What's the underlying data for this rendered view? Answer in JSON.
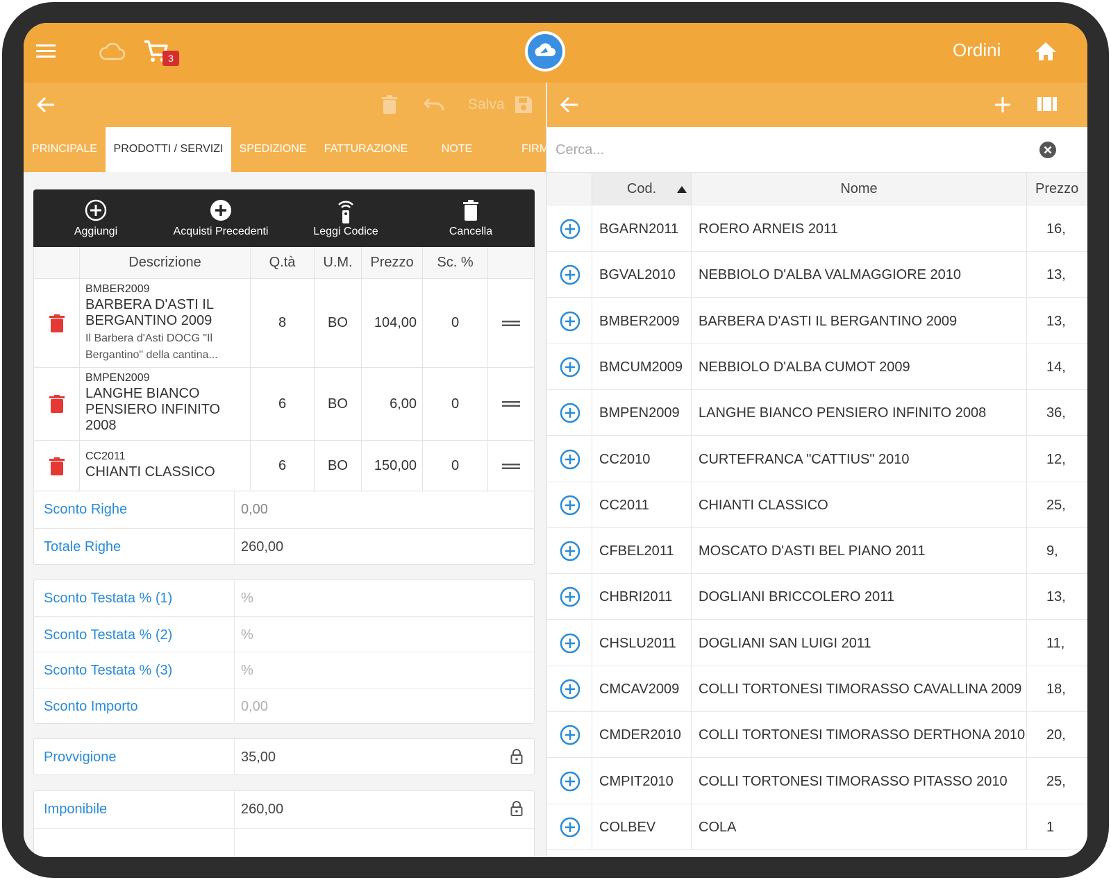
{
  "topbar": {
    "title": "Ordini",
    "cart_count": "3",
    "icons": [
      "menu-icon",
      "cloud-icon",
      "cart-icon",
      "app-logo",
      "home-icon"
    ]
  },
  "left": {
    "save_label": "Salva",
    "tabs": [
      "PRINCIPALE",
      "PRODOTTI / SERVIZI",
      "SPEDIZIONE",
      "FATTURAZIONE",
      "NOTE",
      "FIRMA"
    ],
    "active_tab": "PRODOTTI / SERVIZI",
    "toolbar": {
      "add": "Aggiungi",
      "previous": "Acquisti Precedenti",
      "read": "Leggi Codice",
      "delete": "Cancella"
    },
    "columns": {
      "desc": "Descrizione",
      "qty": "Q.tà",
      "um": "U.M.",
      "price": "Prezzo",
      "disc": "Sc. %"
    },
    "rows": [
      {
        "code": "BMBER2009",
        "name": "BARBERA D'ASTI IL BERGANTINO 2009",
        "note": "Il Barbera d'Asti DOCG \"Il Bergantino\" della cantina...",
        "qty": "8",
        "um": "BO",
        "price": "104,00",
        "disc": "0"
      },
      {
        "code": "BMPEN2009",
        "name": "LANGHE BIANCO PENSIERO INFINITO 2008",
        "note": "",
        "qty": "6",
        "um": "BO",
        "price": "6,00",
        "disc": "0"
      },
      {
        "code": "CC2011",
        "name": "CHIANTI CLASSICO",
        "note": "",
        "qty": "6",
        "um": "BO",
        "price": "150,00",
        "disc": "0"
      }
    ],
    "totals": {
      "sconto_righe_label": "Sconto Righe",
      "sconto_righe": "0,00",
      "totale_righe_label": "Totale Righe",
      "totale_righe": "260,00"
    },
    "header_discounts": {
      "t1_label": "Sconto Testata % (1)",
      "t1": "%",
      "t2_label": "Sconto Testata % (2)",
      "t2": "%",
      "t3_label": "Sconto Testata % (3)",
      "t3": "%",
      "importo_label": "Sconto Importo",
      "importo": "0,00"
    },
    "provvigione_label": "Provvigione",
    "provvigione": "35,00",
    "imponibile_label": "Imponibile",
    "imponibile": "260,00"
  },
  "right": {
    "search_placeholder": "Cerca...",
    "columns": {
      "cod": "Cod.",
      "nome": "Nome",
      "prezzo": "Prezzo"
    },
    "products": [
      {
        "cod": "BGARN2011",
        "nome": "ROERO ARNEIS 2011",
        "prezzo": "16,"
      },
      {
        "cod": "BGVAL2010",
        "nome": "NEBBIOLO D'ALBA VALMAGGIORE 2010",
        "prezzo": "13,"
      },
      {
        "cod": "BMBER2009",
        "nome": "BARBERA D'ASTI IL BERGANTINO 2009",
        "prezzo": "13,"
      },
      {
        "cod": "BMCUM2009",
        "nome": "NEBBIOLO D'ALBA CUMOT 2009",
        "prezzo": "14,"
      },
      {
        "cod": "BMPEN2009",
        "nome": "LANGHE BIANCO PENSIERO INFINITO 2008",
        "prezzo": "36,"
      },
      {
        "cod": "CC2010",
        "nome": "CURTEFRANCA \"CATTIUS\" 2010",
        "prezzo": "12,"
      },
      {
        "cod": "CC2011",
        "nome": "CHIANTI CLASSICO",
        "prezzo": "25,"
      },
      {
        "cod": "CFBEL2011",
        "nome": "MOSCATO D'ASTI BEL PIANO 2011",
        "prezzo": "9,"
      },
      {
        "cod": "CHBRI2011",
        "nome": "DOGLIANI BRICCOLERO 2011",
        "prezzo": "13,"
      },
      {
        "cod": "CHSLU2011",
        "nome": "DOGLIANI SAN LUIGI 2011",
        "prezzo": "11,"
      },
      {
        "cod": "CMCAV2009",
        "nome": "COLLI TORTONESI TIMORASSO CAVALLINA 2009",
        "prezzo": "18,"
      },
      {
        "cod": "CMDER2010",
        "nome": "COLLI TORTONESI TIMORASSO DERTHONA 2010",
        "prezzo": "20,"
      },
      {
        "cod": "CMPIT2010",
        "nome": "COLLI TORTONESI TIMORASSO PITASSO 2010",
        "prezzo": "25,"
      },
      {
        "cod": "COLBEV",
        "nome": "COLA",
        "prezzo": "1"
      }
    ]
  },
  "colors": {
    "orange": "#f2a73b",
    "orange_light": "#f4b24f",
    "link_blue": "#2a8bd8",
    "trash_red": "#e53935",
    "badge_red": "#d32f2f"
  }
}
